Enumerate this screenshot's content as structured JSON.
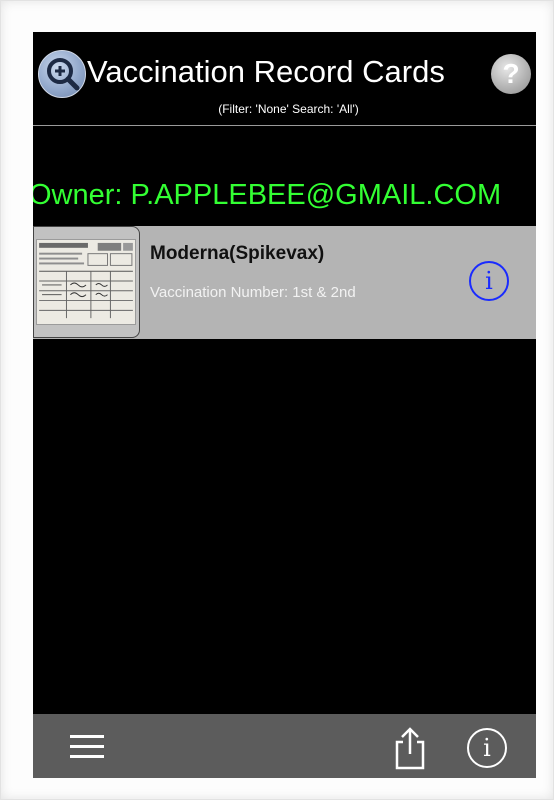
{
  "header": {
    "title": "Vaccination Record Cards",
    "subtitle": "(Filter: 'None' Search: 'All')",
    "help_label": "?",
    "search_icon": "magnifier-plus-icon"
  },
  "owner": {
    "label": "Owner: P.APPLEBEE@GMAIL.COM"
  },
  "records": [
    {
      "name": "Moderna(Spikevax)",
      "detail": "Vaccination Number: 1st & 2nd",
      "thumbnail": "vaccination-card-photo",
      "info_label": "i"
    }
  ],
  "toolbar": {
    "menu_icon": "hamburger-menu-icon",
    "share_icon": "share-icon",
    "info_label": "i"
  },
  "colors": {
    "background": "#000000",
    "owner_text": "#33ff33",
    "row_background": "#b4b4b4",
    "info_accent": "#1a2bff",
    "toolbar": "#5c5c5c"
  }
}
